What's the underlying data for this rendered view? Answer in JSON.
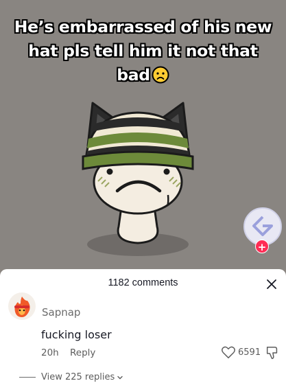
{
  "video": {
    "caption_text": "He’s embarrassed of his new hat pls tell him it not that bad",
    "caption_emoji": "frowning-face-emoji"
  },
  "effect": {
    "icon": "effect-logo-icon",
    "add_symbol": "+"
  },
  "comments_sheet": {
    "header": "1182 comments",
    "close_icon": "close-icon",
    "comment": {
      "username": "Sapnap",
      "text": "fucking loser",
      "time": "20h",
      "reply_label": "Reply",
      "like_count": "6591",
      "view_replies_label": "View 225 replies"
    }
  },
  "colors": {
    "accent": "#fe2c55",
    "video_bg": "#898581"
  }
}
